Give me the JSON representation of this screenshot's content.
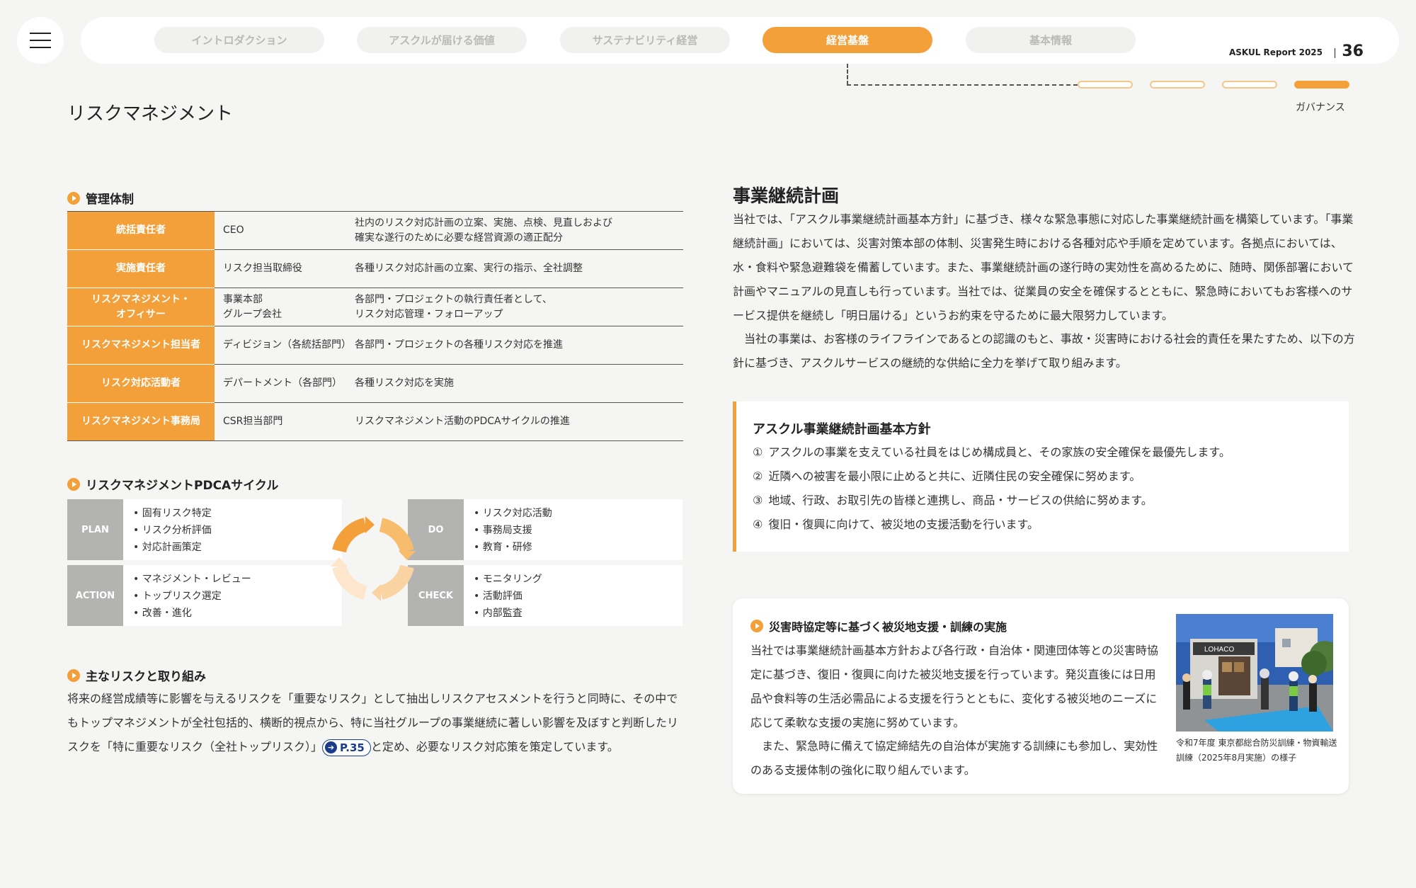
{
  "header": {
    "tabs": [
      {
        "label": "イントロダクション",
        "active": false
      },
      {
        "label": "アスクルが届ける価値",
        "active": false
      },
      {
        "label": "サステナビリティ経営",
        "active": false
      },
      {
        "label": "経営基盤",
        "active": true
      },
      {
        "label": "基本情報",
        "active": false
      }
    ],
    "report_title": "ASKUL Report 2025",
    "page_number": "36",
    "sub_nav_active_label": "ガバナンス",
    "sub_nav_pill_count": 4,
    "sub_nav_active_index": 3
  },
  "page_title": "リスクマネジメント",
  "management": {
    "heading": "管理体制",
    "rows": [
      {
        "role": "統括責任者",
        "who": "CEO",
        "desc": "社内のリスク対応計画の立案、実施、点検、見直しおよび\n確実な遂行のために必要な経営資源の適正配分"
      },
      {
        "role": "実施責任者",
        "who": "リスク担当取締役",
        "desc": "各種リスク対応計画の立案、実行の指示、全社調整"
      },
      {
        "role": "リスクマネジメント・\nオフィサー",
        "who": "事業本部\nグループ会社",
        "desc": "各部門・プロジェクトの執行責任者として、\nリスク対応管理・フォローアップ"
      },
      {
        "role": "リスクマネジメント担当者",
        "who": "ディビジョン（各統括部門）",
        "desc": "各部門・プロジェクトの各種リスク対応を推進"
      },
      {
        "role": "リスク対応活動者",
        "who": "デパートメント（各部門）",
        "desc": "各種リスク対応を実施"
      },
      {
        "role": "リスクマネジメント事務局",
        "who": "CSR担当部門",
        "desc": "リスクマネジメント活動のPDCAサイクルの推進"
      }
    ]
  },
  "pdca": {
    "heading": "リスクマネジメントPDCAサイクル",
    "plan": {
      "label": "PLAN",
      "items": [
        "固有リスク特定",
        "リスク分析評価",
        "対応計画策定"
      ]
    },
    "do": {
      "label": "DO",
      "items": [
        "リスク対応活動",
        "事務局支援",
        "教育・研修"
      ]
    },
    "action": {
      "label": "ACTION",
      "items": [
        "マネジメント・レビュー",
        "トップリスク選定",
        "改善・進化"
      ]
    },
    "check": {
      "label": "CHECK",
      "items": [
        "モニタリング",
        "活動評価",
        "内部監査"
      ]
    }
  },
  "main_risks": {
    "heading": "主なリスクと取り組み",
    "text_before": "将来の経営成績等に影響を与えるリスクを「重要なリスク」として抽出しリスクアセスメントを行うと同時に、その中でもトップマネジメントが全社包括的、横断的視点から、特に当社グループの事業継続に著しい影響を及ぼすと判断したリスクを「特に重要なリスク（全社トップリスク）」",
    "ref_label": "P.35",
    "text_after": "と定め、必要なリスク対応策を策定しています。"
  },
  "bcp": {
    "title": "事業継続計画",
    "paragraph1": "当社では、「アスクル事業継続計画基本方針」に基づき、様々な緊急事態に対応した事業継続計画を構築しています。「事業継続計画」においては、災害対策本部の体制、災害発生時における各種対応や手順を定めています。各拠点においては、水・食料や緊急避難袋を備蓄しています。また、事業継続計画の遂行時の実効性を高めるために、随時、関係部署において計画やマニュアルの見直しも行っています。当社では、従業員の安全を確保するとともに、緊急時においてもお客様へのサービス提供を継続し「明日届ける」というお約束を守るために最大限努力しています。",
    "paragraph2": "当社の事業は、お客様のライフラインであるとの認識のもと、事故・災害時における社会的責任を果たすため、以下の方針に基づき、アスクルサービスの継続的な供給に全力を挙げて取り組みます。"
  },
  "policy": {
    "title": "アスクル事業継続計画基本方針",
    "items": [
      {
        "num": "①",
        "text": "アスクルの事業を支えている社員をはじめ構成員と、その家族の安全確保を最優先します。"
      },
      {
        "num": "②",
        "text": "近隣への被害を最小限に止めると共に、近隣住民の安全確保に努めます。"
      },
      {
        "num": "③",
        "text": "地域、行政、お取引先の皆様と連携し、商品・サービスの供給に努めます。"
      },
      {
        "num": "④",
        "text": "復旧・復興に向けて、被災地の支援活動を行います。"
      }
    ]
  },
  "disaster": {
    "heading": "災害時協定等に基づく被災地支援・訓練の実施",
    "paragraph1": "当社では事業継続計画基本方針および各行政・自治体・関連団体等との災害時協定に基づき、復旧・復興に向けた被災地支援を行っています。発災直後には日用品や食料等の生活必需品による支援を行うとともに、変化する被災地のニーズに応じて柔軟な支援の実施に努めています。",
    "paragraph2": "また、緊急時に備えて協定締結先の自治体が実施する訓練にも参加し、実効性のある支援体制の強化に取り組んでいます。",
    "photo_caption": "令和7年度 東京都総合防災訓練・物資輸送訓練（2025年8月実施）の様子",
    "truck_text": "LOHACO"
  },
  "colors": {
    "accent": "#f4a03a",
    "label_gray": "#b3b4b2",
    "link_blue": "#1a3c8a",
    "background": "#f5f6f4"
  },
  "icons": {
    "menu": "hamburger-icon",
    "section": "play-circle-icon",
    "ref": "arrow-circle-icon"
  }
}
